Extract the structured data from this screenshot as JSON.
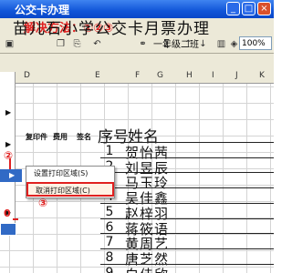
{
  "window": {
    "title": "公交卡办理"
  },
  "annotation": {
    "solution": "解决方法：①②③"
  },
  "toolbar": {
    "zoom": "100%",
    "sigma": "Σ"
  },
  "columns": [
    "D",
    "E",
    "F",
    "G",
    "H",
    "I",
    "J",
    "K"
  ],
  "sheet": {
    "title": "苗儿石小学公交卡月票办理",
    "subtitle": "一年级二班",
    "headers": {
      "copy": "复印件",
      "fee": "费用",
      "sign": "签名",
      "num": "序号",
      "name": "姓名"
    },
    "rows": [
      {
        "num": "1",
        "name": "贺怡茜"
      },
      {
        "num": "2",
        "name": "刘昱辰"
      },
      {
        "num": "3",
        "name": "马玉玲"
      },
      {
        "num": "4",
        "name": "吴佳鑫"
      },
      {
        "num": "5",
        "name": "赵梓羽"
      },
      {
        "num": "6",
        "name": "蒋筱语"
      },
      {
        "num": "7",
        "name": "黄周艺"
      },
      {
        "num": "8",
        "name": "唐芝然"
      },
      {
        "num": "9",
        "name": "白佳欣"
      }
    ]
  },
  "menu": {
    "item_set": "设置打印区域(S)",
    "item_cancel": "取消打印区域(C)",
    "marker2": "②",
    "marker3": "③",
    "marker_big": "0"
  },
  "accent": "#e02020"
}
